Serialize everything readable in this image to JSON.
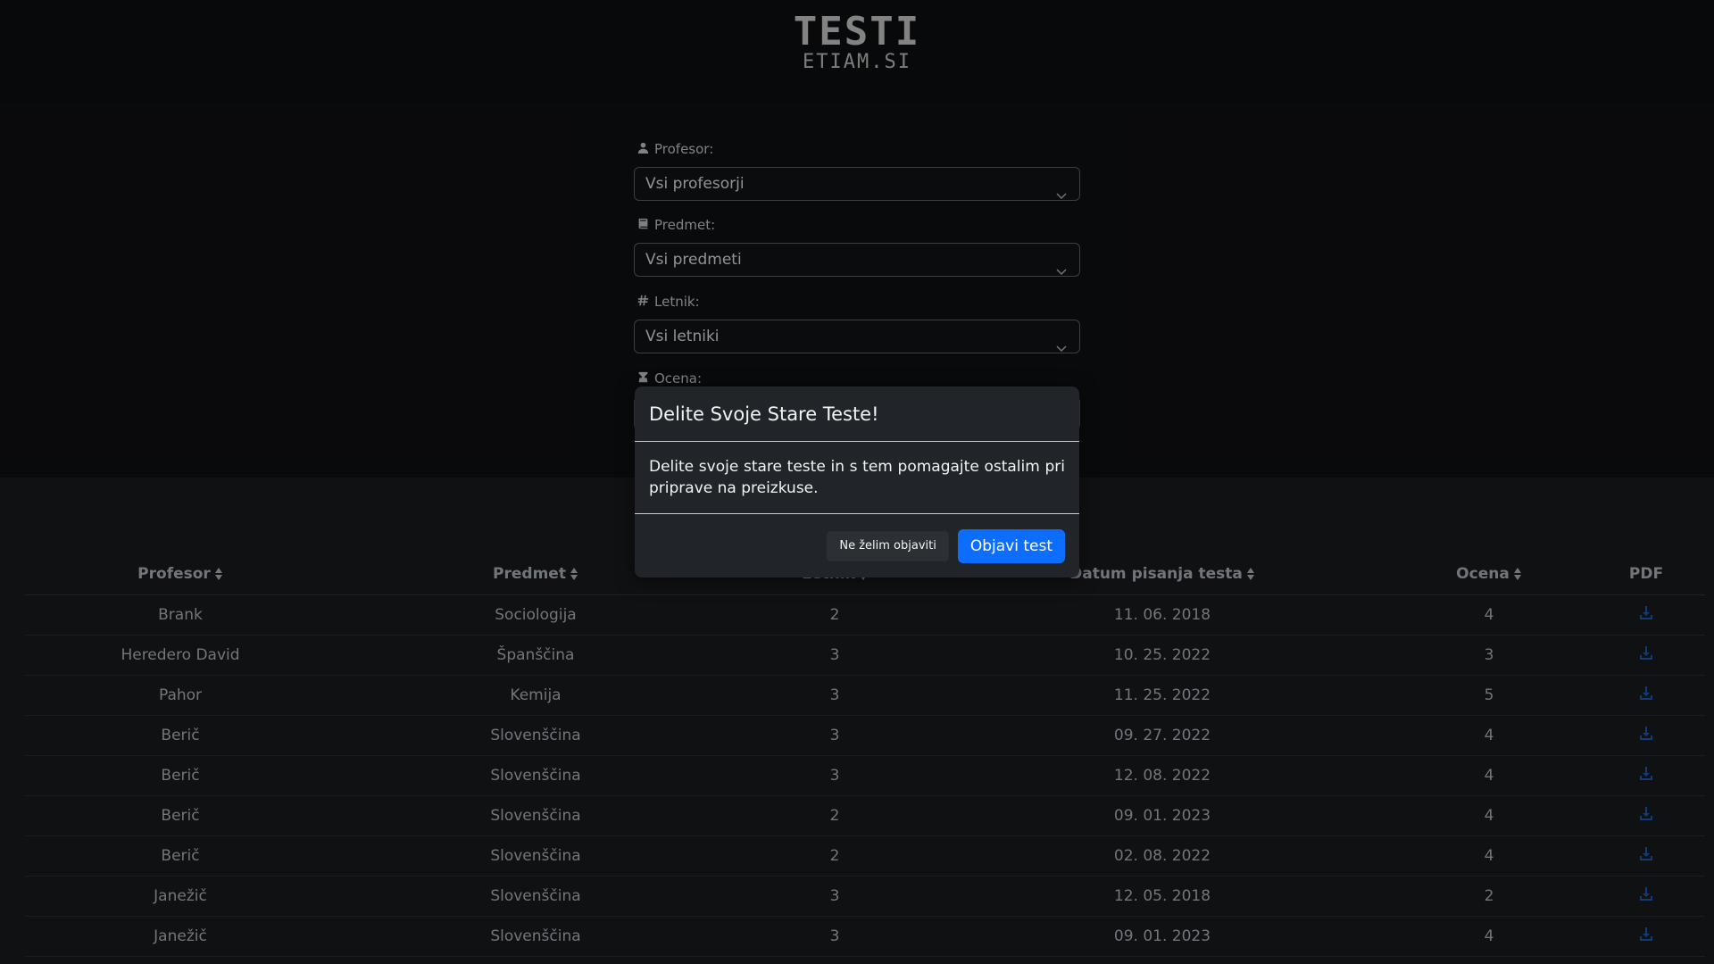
{
  "logo": {
    "mark": "TESTI",
    "sub": "ETIAM.SI"
  },
  "filters": {
    "professor": {
      "label": "Profesor:",
      "value": "Vsi profesorji",
      "icon": "user-icon"
    },
    "subject": {
      "label": "Predmet:",
      "value": "Vsi predmeti",
      "icon": "book-icon"
    },
    "year": {
      "label": "Letnik:",
      "value": "Vsi letniki",
      "icon": "hash-icon"
    },
    "grade": {
      "label": "Ocena:",
      "value": "",
      "icon": "grade-icon"
    }
  },
  "table": {
    "headers": [
      "Profesor",
      "Predmet",
      "Letnik",
      "Datum pisanja testa",
      "Ocena",
      "PDF"
    ],
    "rows": [
      [
        "Brank",
        "Sociologija",
        "2",
        "11. 06. 2018",
        "4"
      ],
      [
        "Heredero David",
        "Španščina",
        "3",
        "10. 25. 2022",
        "3"
      ],
      [
        "Pahor",
        "Kemija",
        "3",
        "11. 25. 2022",
        "5"
      ],
      [
        "Berič",
        "Slovenščina",
        "3",
        "09. 27. 2022",
        "4"
      ],
      [
        "Berič",
        "Slovenščina",
        "3",
        "12. 08. 2022",
        "4"
      ],
      [
        "Berič",
        "Slovenščina",
        "2",
        "09. 01. 2023",
        "4"
      ],
      [
        "Berič",
        "Slovenščina",
        "2",
        "02. 08. 2022",
        "4"
      ],
      [
        "Janežič",
        "Slovenščina",
        "3",
        "12. 05. 2018",
        "2"
      ],
      [
        "Janežič",
        "Slovenščina",
        "3",
        "09. 01. 2023",
        "4"
      ]
    ]
  },
  "modal": {
    "title": "Delite Svoje Stare Teste!",
    "body": "Delite svoje stare teste in s tem pomagajte ostalim pri priprave na preizkuse.",
    "decline_label": "Ne želim objaviti",
    "confirm_label": "Objavi test"
  },
  "colors": {
    "primary": "#0d6efd",
    "download_icon": "#1a5bb8",
    "modal_bg": "#212529"
  }
}
